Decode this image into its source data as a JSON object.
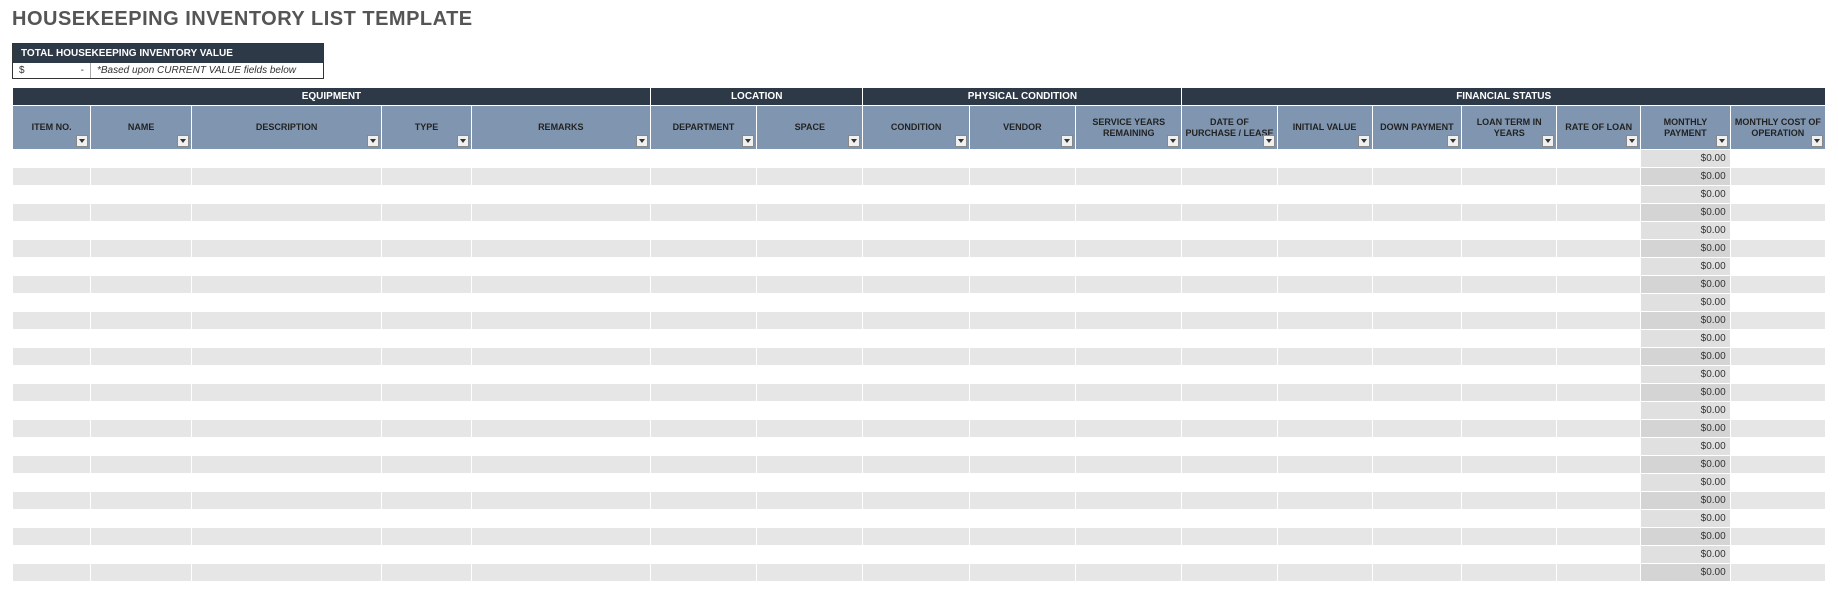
{
  "title": "HOUSEKEEPING INVENTORY LIST TEMPLATE",
  "total": {
    "label": "TOTAL HOUSEKEEPING INVENTORY VALUE",
    "currency": "$",
    "value": "-",
    "note": "*Based upon CURRENT VALUE fields below"
  },
  "groups": {
    "equipment": "EQUIPMENT",
    "location": "LOCATION",
    "physical": "PHYSICAL CONDITION",
    "financial": "FINANCIAL STATUS"
  },
  "columns": {
    "item_no": "ITEM NO.",
    "name": "NAME",
    "description": "DESCRIPTION",
    "type": "TYPE",
    "remarks": "REMARKS",
    "department": "DEPARTMENT",
    "space": "SPACE",
    "condition": "CONDITION",
    "vendor": "VENDOR",
    "service_years": "SERVICE YEARS REMAINING",
    "date_purchase": "DATE OF PURCHASE / LEASE",
    "initial_value": "INITIAL VALUE",
    "down_payment": "DOWN PAYMENT",
    "loan_term": "LOAN TERM IN YEARS",
    "rate": "RATE OF LOAN",
    "monthly_payment": "MONTHLY PAYMENT",
    "monthly_cost": "MONTHLY COST OF OPERATION"
  },
  "rows": [
    {
      "monthly_payment": "$0.00"
    },
    {
      "monthly_payment": "$0.00"
    },
    {
      "monthly_payment": "$0.00"
    },
    {
      "monthly_payment": "$0.00"
    },
    {
      "monthly_payment": "$0.00"
    },
    {
      "monthly_payment": "$0.00"
    },
    {
      "monthly_payment": "$0.00"
    },
    {
      "monthly_payment": "$0.00"
    },
    {
      "monthly_payment": "$0.00"
    },
    {
      "monthly_payment": "$0.00"
    },
    {
      "monthly_payment": "$0.00"
    },
    {
      "monthly_payment": "$0.00"
    },
    {
      "monthly_payment": "$0.00"
    },
    {
      "monthly_payment": "$0.00"
    },
    {
      "monthly_payment": "$0.00"
    },
    {
      "monthly_payment": "$0.00"
    },
    {
      "monthly_payment": "$0.00"
    },
    {
      "monthly_payment": "$0.00"
    },
    {
      "monthly_payment": "$0.00"
    },
    {
      "monthly_payment": "$0.00"
    },
    {
      "monthly_payment": "$0.00"
    },
    {
      "monthly_payment": "$0.00"
    },
    {
      "monthly_payment": "$0.00"
    },
    {
      "monthly_payment": "$0.00"
    }
  ]
}
